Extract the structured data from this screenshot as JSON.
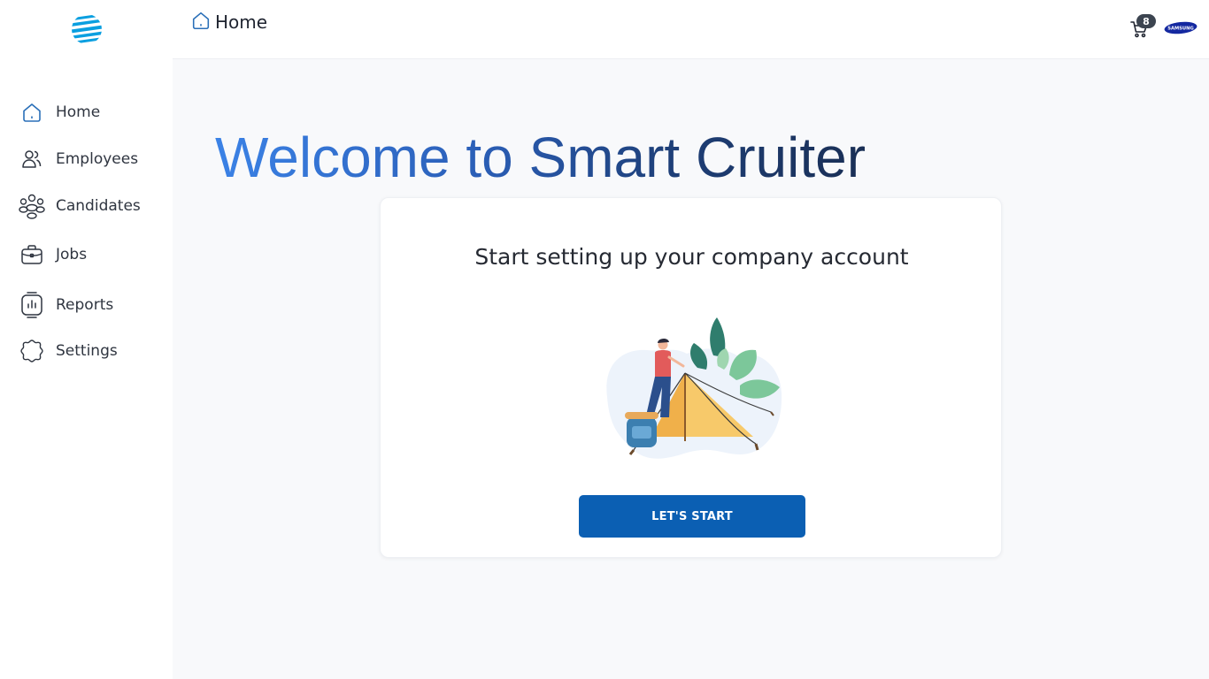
{
  "sidebar": {
    "items": [
      {
        "label": "Home",
        "icon": "home-icon"
      },
      {
        "label": "Employees",
        "icon": "people-icon"
      },
      {
        "label": "Candidates",
        "icon": "group-icon"
      },
      {
        "label": "Jobs",
        "icon": "briefcase-icon"
      },
      {
        "label": "Reports",
        "icon": "report-icon"
      },
      {
        "label": "Settings",
        "icon": "gear-icon"
      }
    ]
  },
  "header": {
    "breadcrumb": "Home",
    "cart_count": "8",
    "brand_logo": "SAMSUNG"
  },
  "main": {
    "welcome": "Welcome to Smart Cruiter",
    "card_title": "Start setting up your company account",
    "start_button": "LET'S START"
  },
  "colors": {
    "accent": "#0b5fb3",
    "title_gradient_start": "#3b82e6",
    "title_gradient_end": "#1a2f55",
    "icon_blue": "#2a6fb8",
    "badge": "#3c4450"
  }
}
